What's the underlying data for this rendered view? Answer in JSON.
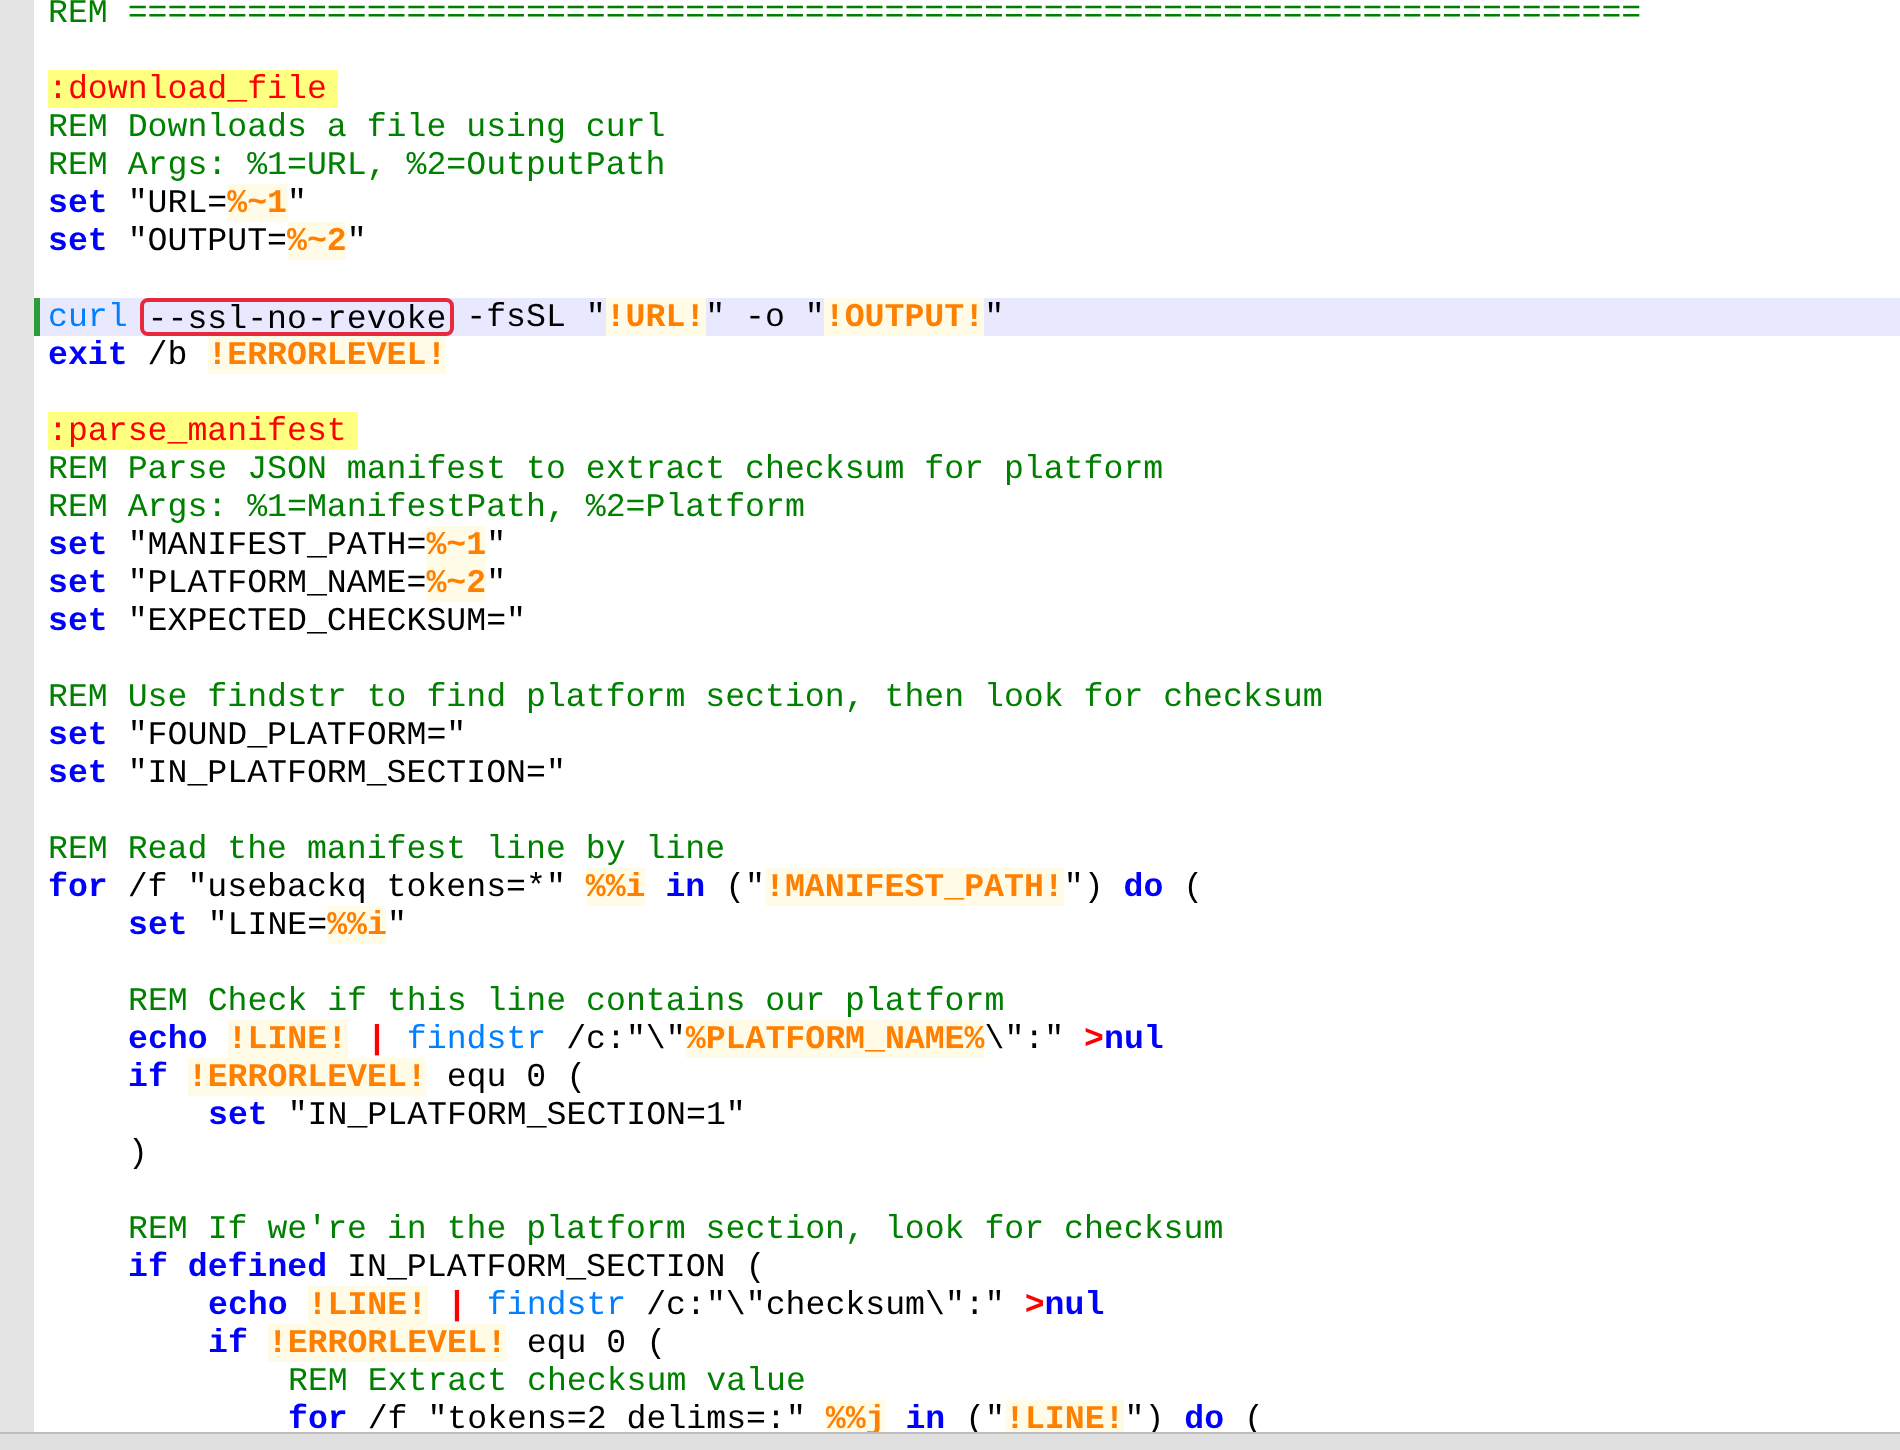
{
  "editor": {
    "lines": [
      {
        "current": false,
        "tokens": [
          {
            "kind": "comment",
            "text": "REM ============================================================================"
          }
        ]
      },
      {
        "current": false
      },
      {
        "current": false,
        "tokens": [
          {
            "kind": "label",
            "text": ":download_file"
          }
        ]
      },
      {
        "current": false,
        "tokens": [
          {
            "kind": "comment",
            "text": "REM Downloads a file using curl"
          }
        ]
      },
      {
        "current": false,
        "tokens": [
          {
            "kind": "comment",
            "text": "REM Args: %1=URL, %2=OutputPath"
          }
        ]
      },
      {
        "current": false,
        "tokens": [
          {
            "kind": "keyword",
            "text": "set"
          },
          {
            "kind": "text",
            "text": " \"URL="
          },
          {
            "kind": "variable",
            "text": "%~1"
          },
          {
            "kind": "text",
            "text": "\""
          }
        ]
      },
      {
        "current": false,
        "tokens": [
          {
            "kind": "keyword",
            "text": "set"
          },
          {
            "kind": "text",
            "text": " \"OUTPUT="
          },
          {
            "kind": "variable",
            "text": "%~2"
          },
          {
            "kind": "text",
            "text": "\""
          }
        ]
      },
      {
        "current": false
      },
      {
        "current": true,
        "tokens": [
          {
            "kind": "command",
            "text": "curl "
          },
          {
            "kind": "annotated",
            "text": "--ssl-no-revoke"
          },
          {
            "kind": "text",
            "text": " -fsSL \""
          },
          {
            "kind": "variable",
            "text": "!URL!"
          },
          {
            "kind": "text",
            "text": "\" -o \""
          },
          {
            "kind": "variable",
            "text": "!OUTPUT!"
          },
          {
            "kind": "text",
            "text": "\""
          }
        ]
      },
      {
        "current": false,
        "tokens": [
          {
            "kind": "keyword",
            "text": "exit"
          },
          {
            "kind": "text",
            "text": " /b "
          },
          {
            "kind": "variable",
            "text": "!ERRORLEVEL!"
          }
        ]
      },
      {
        "current": false
      },
      {
        "current": false,
        "tokens": [
          {
            "kind": "label",
            "text": ":parse_manifest"
          }
        ]
      },
      {
        "current": false,
        "tokens": [
          {
            "kind": "comment",
            "text": "REM Parse JSON manifest to extract checksum for platform"
          }
        ]
      },
      {
        "current": false,
        "tokens": [
          {
            "kind": "comment",
            "text": "REM Args: %1=ManifestPath, %2=Platform"
          }
        ]
      },
      {
        "current": false,
        "tokens": [
          {
            "kind": "keyword",
            "text": "set"
          },
          {
            "kind": "text",
            "text": " \"MANIFEST_PATH="
          },
          {
            "kind": "variable",
            "text": "%~1"
          },
          {
            "kind": "text",
            "text": "\""
          }
        ]
      },
      {
        "current": false,
        "tokens": [
          {
            "kind": "keyword",
            "text": "set"
          },
          {
            "kind": "text",
            "text": " \"PLATFORM_NAME="
          },
          {
            "kind": "variable",
            "text": "%~2"
          },
          {
            "kind": "text",
            "text": "\""
          }
        ]
      },
      {
        "current": false,
        "tokens": [
          {
            "kind": "keyword",
            "text": "set"
          },
          {
            "kind": "text",
            "text": " \"EXPECTED_CHECKSUM=\""
          }
        ]
      },
      {
        "current": false
      },
      {
        "current": false,
        "tokens": [
          {
            "kind": "comment",
            "text": "REM Use findstr to find platform section, then look for checksum"
          }
        ]
      },
      {
        "current": false,
        "tokens": [
          {
            "kind": "keyword",
            "text": "set"
          },
          {
            "kind": "text",
            "text": " \"FOUND_PLATFORM=\""
          }
        ]
      },
      {
        "current": false,
        "tokens": [
          {
            "kind": "keyword",
            "text": "set"
          },
          {
            "kind": "text",
            "text": " \"IN_PLATFORM_SECTION=\""
          }
        ]
      },
      {
        "current": false
      },
      {
        "current": false,
        "tokens": [
          {
            "kind": "comment",
            "text": "REM Read the manifest line by line"
          }
        ]
      },
      {
        "current": false,
        "tokens": [
          {
            "kind": "keyword",
            "text": "for"
          },
          {
            "kind": "text",
            "text": " /f \"usebackq tokens=*\" "
          },
          {
            "kind": "variable",
            "text": "%%i"
          },
          {
            "kind": "keyword",
            "text": " in"
          },
          {
            "kind": "text",
            "text": " (\""
          },
          {
            "kind": "variable",
            "text": "!MANIFEST_PATH!"
          },
          {
            "kind": "text",
            "text": "\") "
          },
          {
            "kind": "keyword",
            "text": "do"
          },
          {
            "kind": "text",
            "text": " ("
          }
        ],
        "children": [
          {
            "current": false,
            "tokens": [
              {
                "kind": "keyword",
                "text": "set"
              },
              {
                "kind": "text",
                "text": " \"LINE="
              },
              {
                "kind": "variable",
                "text": "%%i"
              },
              {
                "kind": "text",
                "text": "\""
              }
            ]
          },
          {
            "current": false
          },
          {
            "current": false,
            "tokens": [
              {
                "kind": "comment",
                "text": "REM Check if this line contains our platform"
              }
            ]
          },
          {
            "current": false,
            "tokens": [
              {
                "kind": "keyword",
                "text": "echo "
              },
              {
                "kind": "variable",
                "text": "!LINE!"
              },
              {
                "kind": "operator",
                "text": " | "
              },
              {
                "kind": "command",
                "text": "findstr"
              },
              {
                "kind": "text",
                "text": " /c:\"\\\""
              },
              {
                "kind": "variable",
                "text": "%PLATFORM_NAME%"
              },
              {
                "kind": "text",
                "text": "\\\":\" "
              },
              {
                "kind": "operator",
                "text": ">"
              },
              {
                "kind": "keyword",
                "text": "nul"
              }
            ]
          },
          {
            "current": false,
            "tokens": [
              {
                "kind": "keyword",
                "text": "if "
              },
              {
                "kind": "variable",
                "text": "!ERRORLEVEL!"
              },
              {
                "kind": "text",
                "text": " equ 0 ("
              }
            ],
            "children": [
              {
                "current": false,
                "tokens": [
                  {
                    "kind": "keyword",
                    "text": "set"
                  },
                  {
                    "kind": "text",
                    "text": " \"IN_PLATFORM_SECTION=1\""
                  }
                ]
              }
            ]
          },
          {
            "current": false,
            "tokens": [
              {
                "kind": "text",
                "text": ")"
              }
            ]
          },
          {
            "current": false
          },
          {
            "current": false,
            "tokens": [
              {
                "kind": "comment",
                "text": "REM If we're in the platform section, look for checksum"
              }
            ]
          },
          {
            "current": false,
            "tokens": [
              {
                "kind": "keyword",
                "text": "if defined"
              },
              {
                "kind": "text",
                "text": " IN_PLATFORM_SECTION ("
              }
            ],
            "children": [
              {
                "current": false,
                "tokens": [
                  {
                    "kind": "keyword",
                    "text": "echo "
                  },
                  {
                    "kind": "variable",
                    "text": "!LINE!"
                  },
                  {
                    "kind": "operator",
                    "text": " | "
                  },
                  {
                    "kind": "command",
                    "text": "findstr"
                  },
                  {
                    "kind": "text",
                    "text": " /c:\"\\\"checksum\\\":\" "
                  },
                  {
                    "kind": "operator",
                    "text": ">"
                  },
                  {
                    "kind": "keyword",
                    "text": "nul"
                  }
                ]
              },
              {
                "current": false,
                "tokens": [
                  {
                    "kind": "keyword",
                    "text": "if "
                  },
                  {
                    "kind": "variable",
                    "text": "!ERRORLEVEL!"
                  },
                  {
                    "kind": "text",
                    "text": " equ 0 ("
                  }
                ],
                "children": [
                  {
                    "current": false,
                    "tokens": [
                      {
                        "kind": "comment",
                        "text": "REM Extract checksum value"
                      }
                    ]
                  },
                  {
                    "current": false,
                    "tokens": [
                      {
                        "kind": "keyword",
                        "text": "for"
                      },
                      {
                        "kind": "text",
                        "text": " /f \"tokens=2 delims=:\" "
                      },
                      {
                        "kind": "variable",
                        "text": "%%j"
                      },
                      {
                        "kind": "keyword",
                        "text": " in"
                      },
                      {
                        "kind": "text",
                        "text": " (\""
                      },
                      {
                        "kind": "variable",
                        "text": "!LINE!"
                      },
                      {
                        "kind": "text",
                        "text": "\") "
                      },
                      {
                        "kind": "keyword",
                        "text": "do"
                      },
                      {
                        "kind": "text",
                        "text": " ("
                      }
                    ]
                  }
                ]
              }
            ]
          }
        ]
      }
    ]
  }
}
